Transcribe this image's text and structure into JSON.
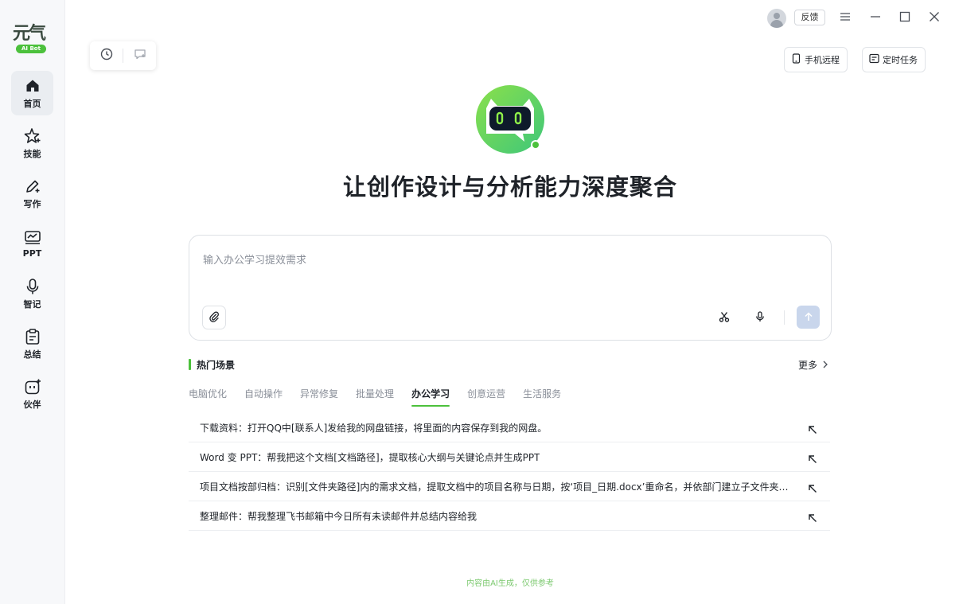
{
  "app": {
    "logo_text": "元气",
    "logo_badge": "AI Bot"
  },
  "sidebar": {
    "items": [
      {
        "label": "首页",
        "icon": "home-icon",
        "active": true
      },
      {
        "label": "技能",
        "icon": "sparkle-icon",
        "active": false
      },
      {
        "label": "写作",
        "icon": "pen-icon",
        "active": false
      },
      {
        "label": "PPT",
        "icon": "presentation-icon",
        "active": false
      },
      {
        "label": "智记",
        "icon": "microphone-icon",
        "active": false
      },
      {
        "label": "总结",
        "icon": "clipboard-icon",
        "active": false
      },
      {
        "label": "伙伴",
        "icon": "bot-face-icon",
        "active": false
      }
    ]
  },
  "topbar": {
    "feedback_label": "反馈",
    "phone_remote_label": "手机远程",
    "scheduled_task_label": "定时任务"
  },
  "hero": {
    "headline": "让创作设计与分析能力深度聚合"
  },
  "composer": {
    "placeholder": "输入办公学习提效需求"
  },
  "hot": {
    "title": "热门场景",
    "more_label": "更多",
    "tabs": [
      "电脑优化",
      "自动操作",
      "异常修复",
      "批量处理",
      "办公学习",
      "创意运营",
      "生活服务"
    ],
    "active_tab": "办公学习",
    "items": [
      "下载资料：打开QQ中[联系人]发给我的网盘链接，将里面的内容保存到我的网盘。",
      "Word 变 PPT：帮我把这个文档[文档路径]，提取核心大纲与关键论点并生成PPT",
      "项目文档按部归档：识别[文件夹路径]内的需求文档，提取文档中的项目名称与日期，按‘项目_日期.docx’重命名，并依部门建立子文件夹归类存放",
      "整理邮件：帮我整理飞书邮箱中今日所有未读邮件并总结内容给我"
    ]
  },
  "footer": {
    "note": "内容由AI生成，仅供参考"
  },
  "colors": {
    "accent": "#4cc13c",
    "send_disabled": "#c9d6ec",
    "sidebar_bg": "#f7f8fa"
  }
}
